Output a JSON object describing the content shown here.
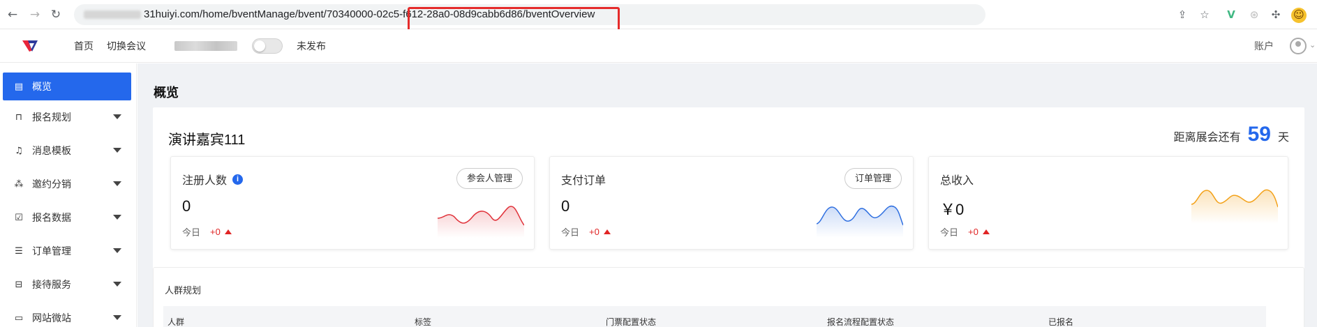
{
  "browser": {
    "back_glyph": "←",
    "forward_glyph": "→",
    "reload_glyph": "↻",
    "url_visible": "31huiyi.com/home/bventManage/bvent/70340000-02c5-f612-28a0-08d9cabb6d86/bventOverview",
    "extension_icons": [
      "share-icon",
      "star-icon",
      "vue-extension-icon",
      "extension-icon-gray",
      "puzzle-icon",
      "emoji-avatar-icon"
    ]
  },
  "header": {
    "nav_home": "首页",
    "nav_switch": "切换会议",
    "publish_status": "未发布",
    "account_label": "账户"
  },
  "sidebar": {
    "items": [
      {
        "label": "概览",
        "icon": "overview-icon",
        "active": true
      },
      {
        "label": "报名规划",
        "icon": "bookmark-icon"
      },
      {
        "label": "消息模板",
        "icon": "bell-icon"
      },
      {
        "label": "邀约分销",
        "icon": "network-icon"
      },
      {
        "label": "报名数据",
        "icon": "clipboard-icon"
      },
      {
        "label": "订单管理",
        "icon": "list-icon"
      },
      {
        "label": "接待服务",
        "icon": "bus-icon"
      },
      {
        "label": "网站微站",
        "icon": "monitor-icon"
      }
    ]
  },
  "main": {
    "page_title": "概览",
    "event_title": "演讲嘉宾111",
    "countdown_prefix": "距离展会还有",
    "countdown_days": "59",
    "countdown_suffix": "天",
    "stats": [
      {
        "label": "注册人数",
        "value": "0",
        "today_label": "今日",
        "delta": "+0",
        "button": "参会人管理",
        "color": "#e0323a"
      },
      {
        "label": "支付订单",
        "value": "0",
        "today_label": "今日",
        "delta": "+0",
        "button": "订单管理",
        "color": "#2f6fe0"
      },
      {
        "label": "总收入",
        "value": "￥0",
        "today_label": "今日",
        "delta": "+0",
        "button": "",
        "color": "#f3a21a"
      }
    ],
    "crowd": {
      "title": "人群规划",
      "columns": [
        "人群",
        "标签",
        "门票配置状态",
        "报名流程配置状态",
        "已报名"
      ]
    }
  }
}
